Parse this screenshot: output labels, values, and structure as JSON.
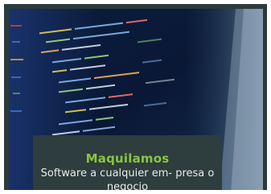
{
  "card": {
    "title": "Maquilamos",
    "text": "Software a cualquier em- presa o negocio",
    "colors": {
      "frame": "#2c3a3b",
      "caption_bg": "#2e3d3d",
      "title": "#8bc53f",
      "text": "#e8ecea"
    }
  },
  "background_image": {
    "subject": "code-editor-screen-photo"
  }
}
